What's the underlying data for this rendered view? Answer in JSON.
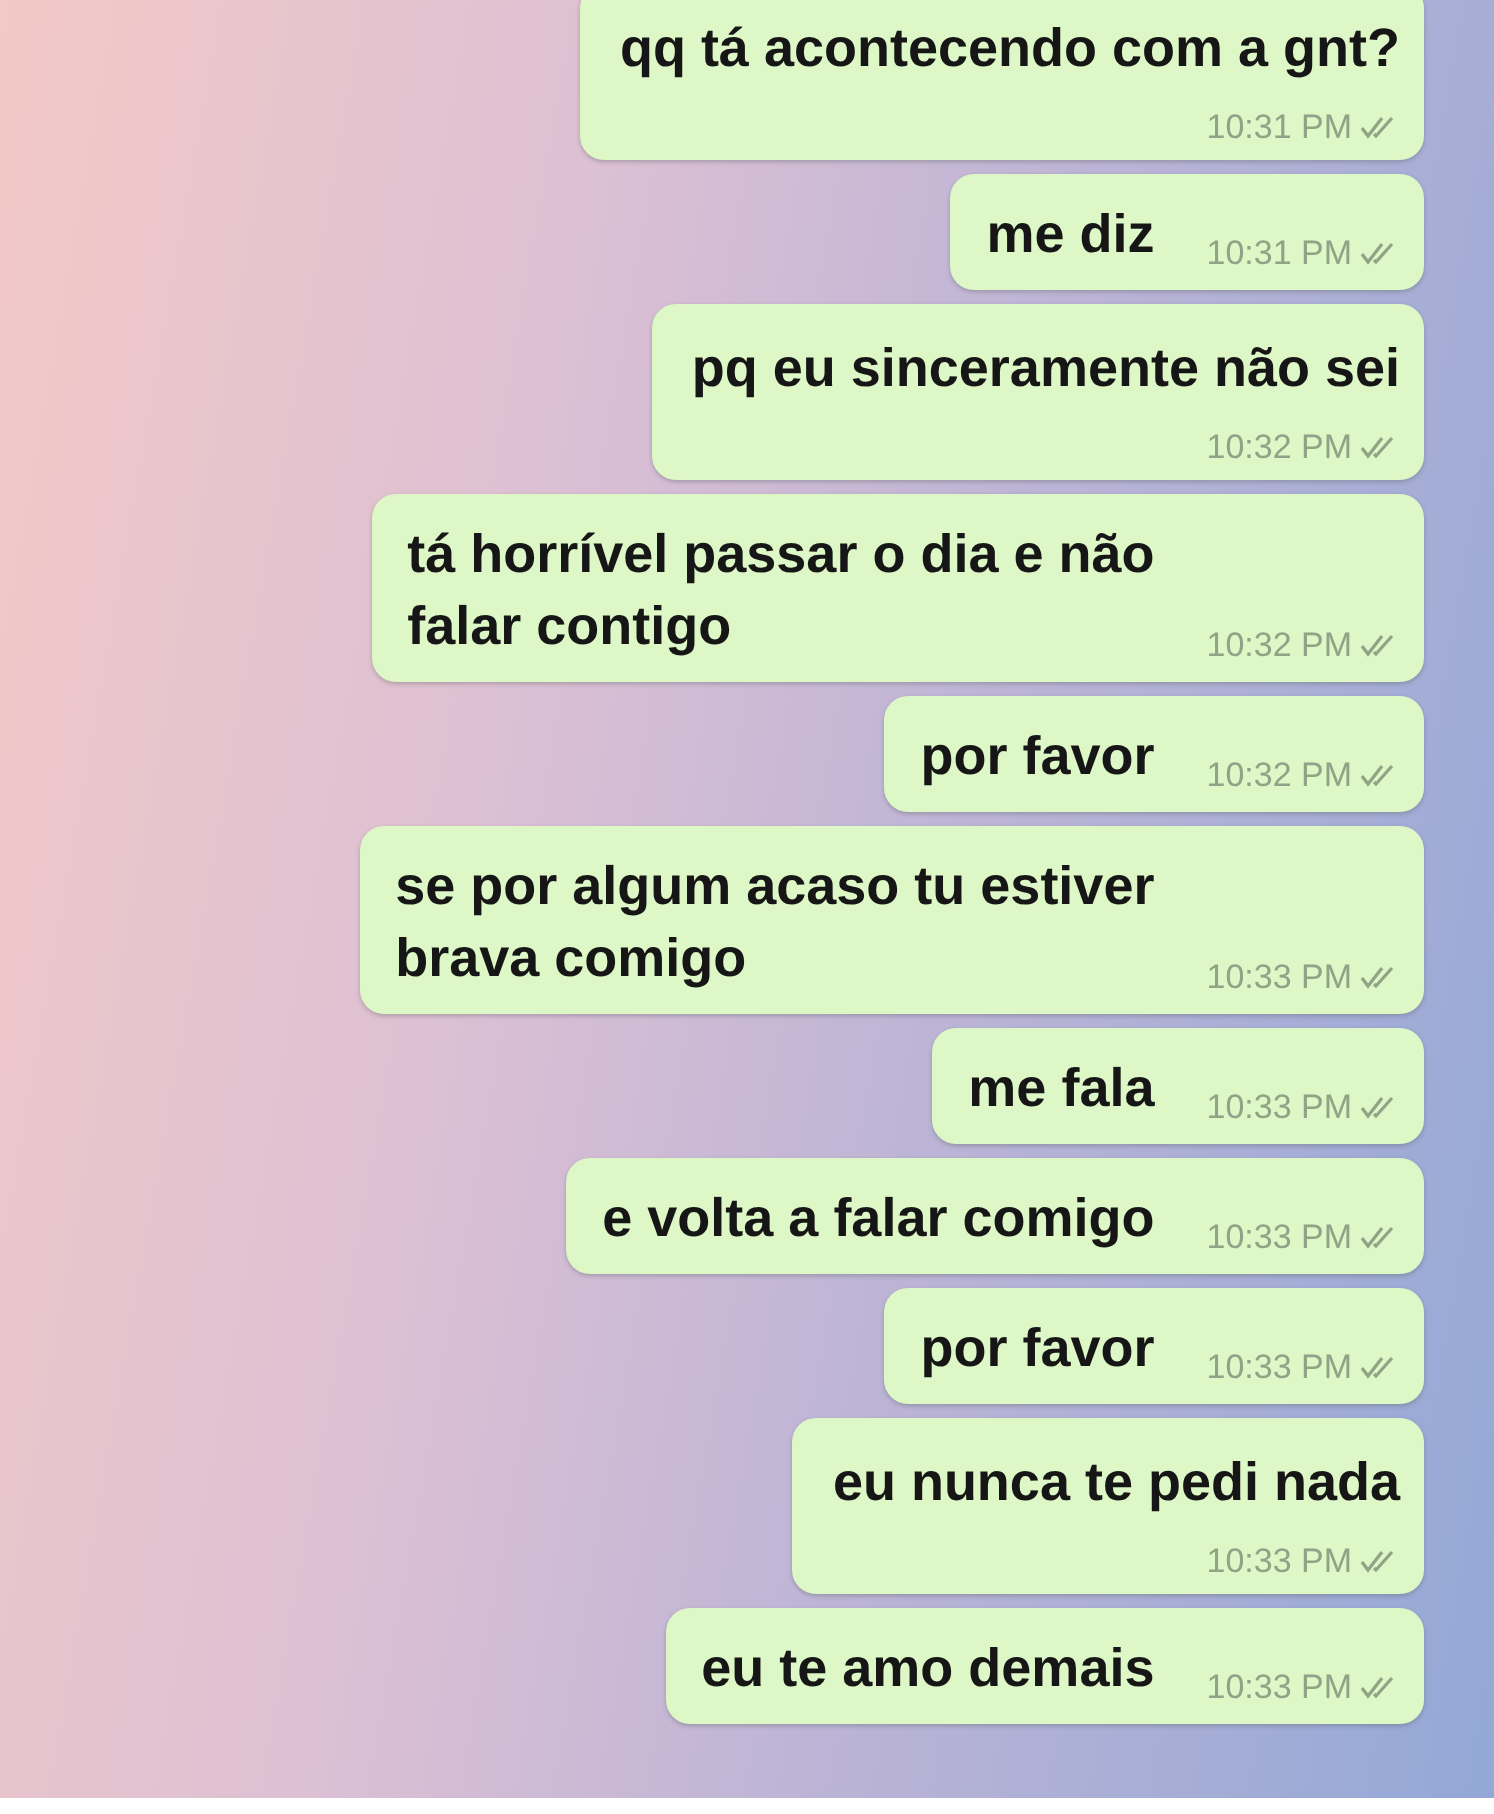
{
  "messages": [
    {
      "kind": "stacked",
      "lines": [
        "qq tá acontecendo com a gnt?"
      ],
      "time": "10:31 PM"
    },
    {
      "kind": "inline",
      "lines": [
        "me diz"
      ],
      "time": "10:31 PM"
    },
    {
      "kind": "stacked",
      "lines": [
        "pq eu sinceramente não sei"
      ],
      "time": "10:32 PM"
    },
    {
      "kind": "inline",
      "lines": [
        "tá horrível passar o dia e não",
        "falar contigo"
      ],
      "time": "10:32 PM"
    },
    {
      "kind": "inline",
      "lines": [
        "por favor"
      ],
      "time": "10:32 PM"
    },
    {
      "kind": "inline",
      "lines": [
        "se por algum acaso tu estiver",
        "brava comigo"
      ],
      "time": "10:33 PM"
    },
    {
      "kind": "inline",
      "lines": [
        "me fala"
      ],
      "time": "10:33 PM"
    },
    {
      "kind": "inline",
      "lines": [
        "e volta a falar comigo"
      ],
      "time": "10:33 PM"
    },
    {
      "kind": "inline",
      "lines": [
        "por favor"
      ],
      "time": "10:33 PM"
    },
    {
      "kind": "stacked",
      "lines": [
        "eu nunca te pedi nada"
      ],
      "time": "10:33 PM"
    },
    {
      "kind": "inline",
      "lines": [
        "eu te amo demais"
      ],
      "time": "10:33 PM"
    }
  ]
}
